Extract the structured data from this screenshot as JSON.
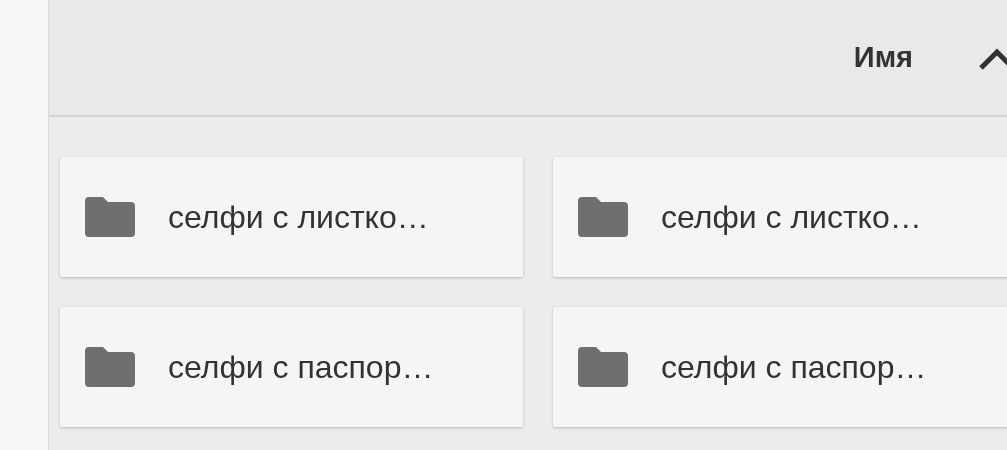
{
  "sort": {
    "label": "Имя",
    "ascending": true
  },
  "folders": [
    {
      "name": "селфи с листко…"
    },
    {
      "name": "селфи с листко…"
    },
    {
      "name": "селфи с паспор…"
    },
    {
      "name": "селфи с паспор…"
    }
  ]
}
